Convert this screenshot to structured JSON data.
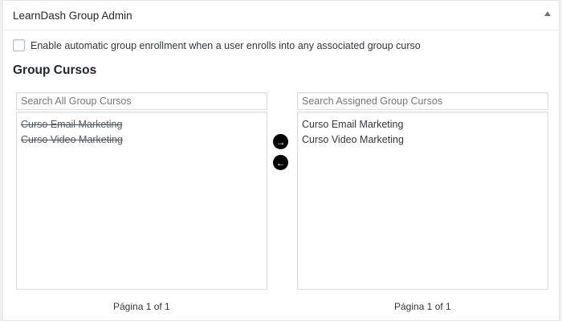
{
  "metabox": {
    "title": "LearnDash Group Admin"
  },
  "enrollment": {
    "label": "Enable automatic group enrollment when a user enrolls into any associated group curso"
  },
  "section": {
    "title": "Group Cursos"
  },
  "left_panel": {
    "search_placeholder": "Search All Group Cursos",
    "items": [
      "Curso Email Marketing",
      "Curso Video Marketing"
    ],
    "pager": "Página 1 of 1"
  },
  "right_panel": {
    "search_placeholder": "Search Assigned Group Cursos",
    "items": [
      "Curso Email Marketing",
      "Curso Video Marketing"
    ],
    "pager": "Página 1 of 1"
  },
  "controls": {
    "add_icon": "→",
    "remove_icon": "←"
  },
  "colors": {
    "accent": "#000000",
    "border": "#dddddd"
  }
}
